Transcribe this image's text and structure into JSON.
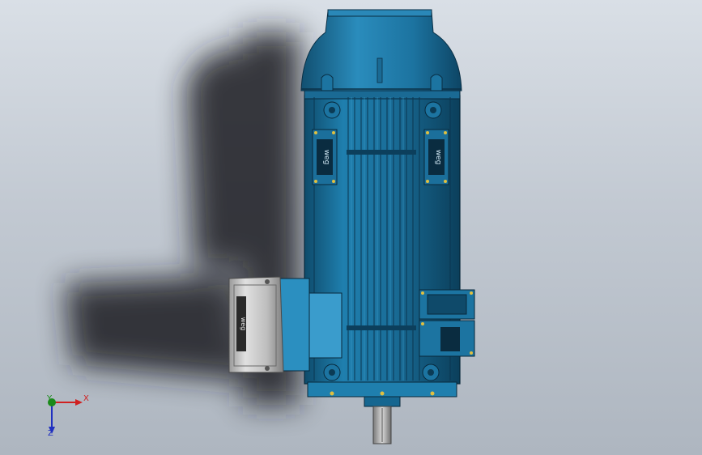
{
  "viewport": {
    "background_top": "#d9dfe6",
    "background_bottom": "#aeb6c0"
  },
  "model": {
    "body_color": "#1b6f9b",
    "body_dark": "#0f4a6a",
    "housing_gray": "#c8c8c8",
    "nameplate_text": "weg"
  },
  "triad": {
    "x_label": "X",
    "y_label": "Y",
    "z_label": "Z",
    "x_color": "#d02020",
    "y_color": "#1a8a1a",
    "z_color": "#2030c0"
  }
}
